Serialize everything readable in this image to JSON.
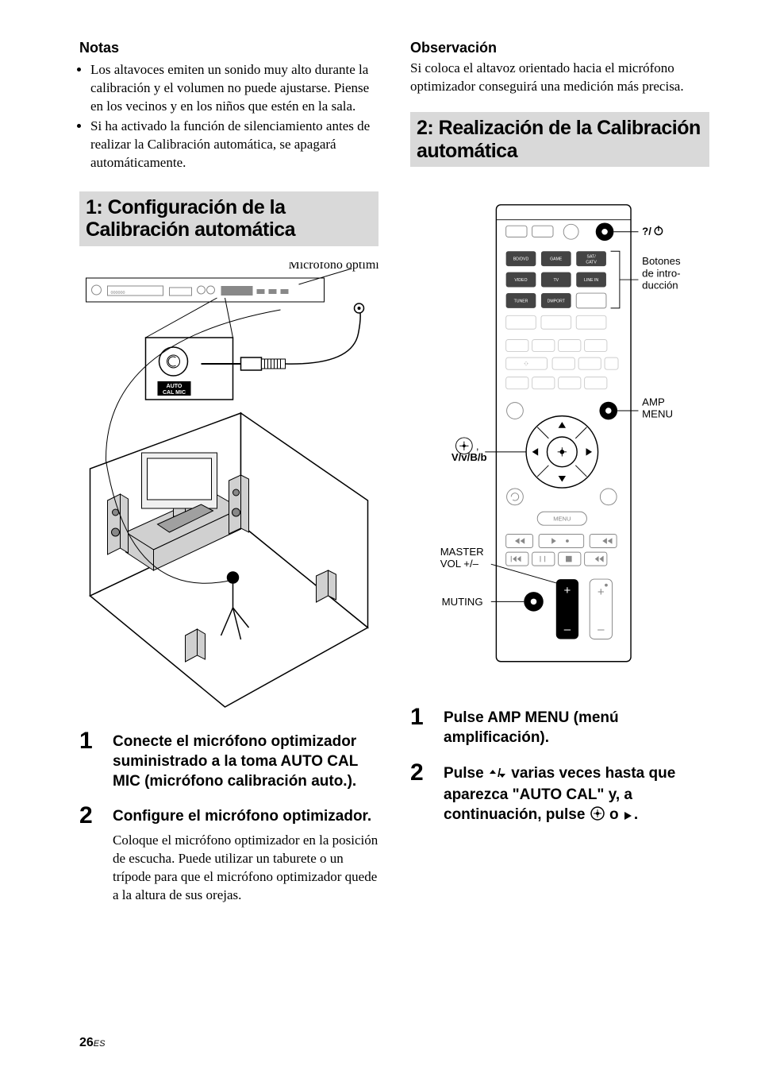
{
  "left": {
    "notas_heading": "Notas",
    "notas_items": [
      "Los altavoces emiten un sonido muy alto durante la calibración y el volumen no puede ajustarse. Piense en los vecinos y en los niños que estén en la sala.",
      "Si ha activado la función de silenciamiento antes de realizar la Calibración automática, se apagará automáticamente."
    ],
    "section1_title": "1: Configuración de la Calibración automática",
    "fig1_label_mic": "Micrófono optimizador",
    "fig1_jack_label1": "AUTO",
    "fig1_jack_label2": "CAL MIC",
    "step1_num": "1",
    "step1_title": "Conecte el micrófono optimizador suministrado a la toma AUTO CAL MIC (micrófono calibración auto.).",
    "step2_num": "2",
    "step2_title": "Configure el micrófono optimizador.",
    "step2_desc": "Coloque el micrófono optimizador en la posición de escucha. Puede utilizar un taburete o un trípode para que el micrófono optimizador quede a la altura de sus orejas."
  },
  "right": {
    "obs_heading": "Observación",
    "obs_text": "Si coloca el altavoz orientado hacia el micrófono optimizador conseguirá una medición más precisa.",
    "section2_title": "2: Realización de la Calibración automática",
    "remote": {
      "power": "?/1",
      "input_label1": "Botones",
      "input_label2": "de intro-",
      "input_label3": "ducción",
      "btn_bddvd": "BD/DVD",
      "btn_game": "GAME",
      "btn_satcatv1": "SAT/",
      "btn_satcatv2": "CATV",
      "btn_video": "VIDEO",
      "btn_tv": "TV",
      "btn_linein": "LINE IN",
      "btn_tuner": "TUNER",
      "btn_dmport": "DMPORT",
      "amp_menu1": "AMP",
      "amp_menu2": "MENU",
      "dpad_symbols": "V/v/B/b",
      "menu_btn": "MENU",
      "master_vol1": "MASTER",
      "master_vol2": "VOL +/–",
      "muting": "MUTING"
    },
    "step1_num": "1",
    "step1_title": "Pulse AMP MENU (menú amplificación).",
    "step2_num": "2",
    "step2_title_a": "Pulse ",
    "step2_title_b": " varias veces hasta que aparezca \"AUTO CAL\" y, a continuación, pulse ",
    "step2_title_c": " o ",
    "step2_title_d": "."
  },
  "page_number": "26",
  "page_lang": "ES"
}
